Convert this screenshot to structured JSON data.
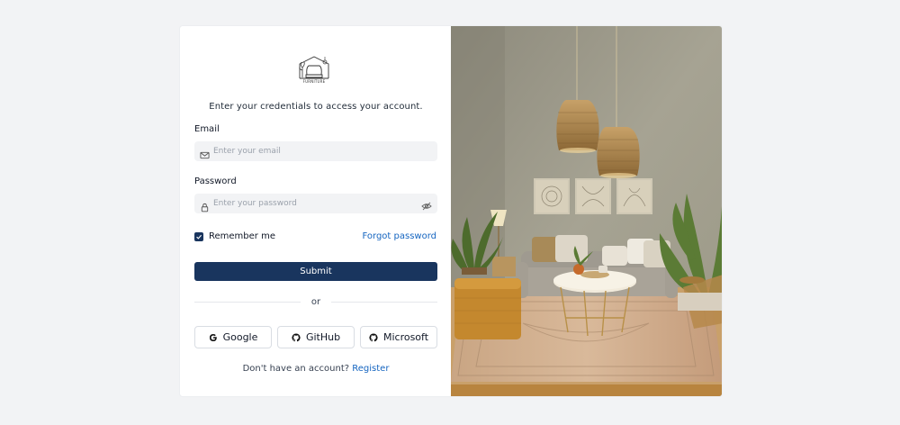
{
  "brand": {
    "logo_icon": "furniture-logo-icon",
    "logo_text": "FURNITURE"
  },
  "login": {
    "subtitle": "Enter your credentials to access your account.",
    "email_label": "Email",
    "email_placeholder": "Enter your email",
    "email_value": "",
    "password_label": "Password",
    "password_placeholder": "Enter your password",
    "password_value": "",
    "remember_label": "Remember me",
    "remember_checked": true,
    "forgot_label": "Forgot password",
    "submit_label": "Submit",
    "divider_text": "or",
    "social_buttons": [
      {
        "label": "Google",
        "icon": "google-icon"
      },
      {
        "label": "GitHub",
        "icon": "github-icon"
      },
      {
        "label": "Microsoft",
        "icon": "github-icon"
      }
    ],
    "register_prompt": "Don't have an account?",
    "register_link": "Register"
  },
  "colors": {
    "primary": "#19355e",
    "link": "#1565c0",
    "field_bg": "#f2f3f5",
    "page_bg": "#f2f3f5"
  },
  "hero_image": {
    "description_icon": "living-room-photo"
  }
}
